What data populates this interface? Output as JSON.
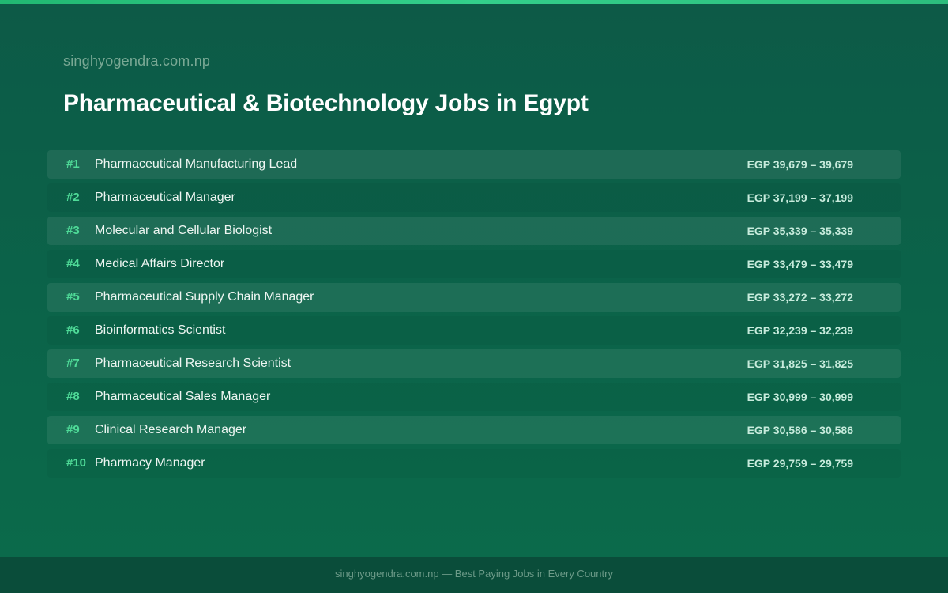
{
  "site": "singhyogendra.com.np",
  "title": "Pharmaceutical & Biotechnology Jobs in Egypt",
  "jobs": [
    {
      "rank": "#1",
      "title": "Pharmaceutical Manufacturing Lead",
      "salary": "EGP 39,679 – 39,679"
    },
    {
      "rank": "#2",
      "title": "Pharmaceutical Manager",
      "salary": "EGP 37,199 – 37,199"
    },
    {
      "rank": "#3",
      "title": "Molecular and Cellular Biologist",
      "salary": "EGP 35,339 – 35,339"
    },
    {
      "rank": "#4",
      "title": "Medical Affairs Director",
      "salary": "EGP 33,479 – 33,479"
    },
    {
      "rank": "#5",
      "title": "Pharmaceutical Supply Chain Manager",
      "salary": "EGP 33,272 – 33,272"
    },
    {
      "rank": "#6",
      "title": "Bioinformatics Scientist",
      "salary": "EGP 32,239 – 32,239"
    },
    {
      "rank": "#7",
      "title": "Pharmaceutical Research Scientist",
      "salary": "EGP 31,825 – 31,825"
    },
    {
      "rank": "#8",
      "title": "Pharmaceutical Sales Manager",
      "salary": "EGP 30,999 – 30,999"
    },
    {
      "rank": "#9",
      "title": "Clinical Research Manager",
      "salary": "EGP 30,586 – 30,586"
    },
    {
      "rank": "#10",
      "title": "Pharmacy Manager",
      "salary": "EGP 29,759 – 29,759"
    }
  ],
  "footer": "singhyogendra.com.np — Best Paying Jobs in Every Country",
  "colors": {
    "accent": "#4fdb98",
    "background": "#0b6349",
    "top_bar": "#2cc27f",
    "footer_bg": "#0a4d3a"
  }
}
